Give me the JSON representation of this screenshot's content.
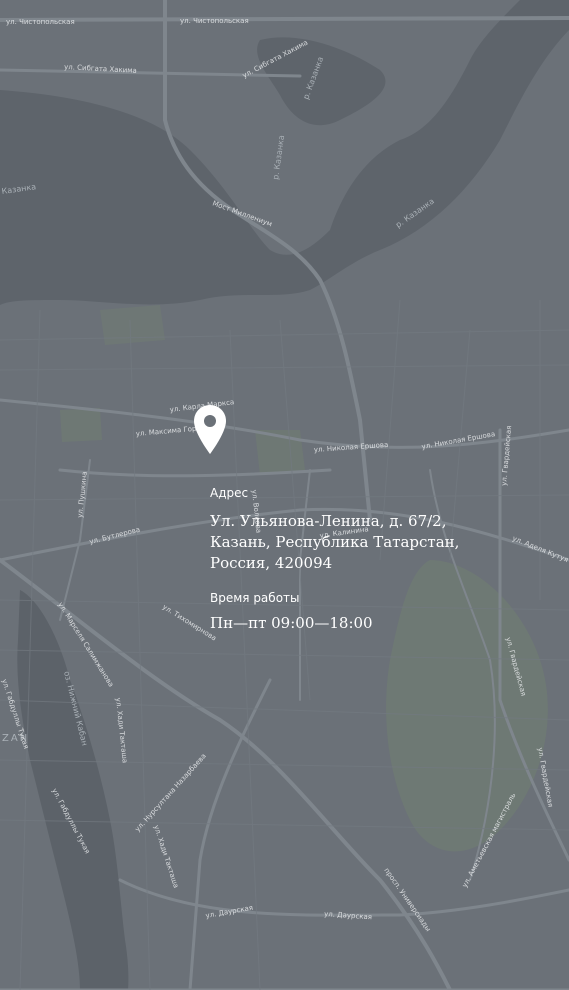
{
  "contact": {
    "address_label": "Адрес",
    "address_value": "Ул. Ульянова-Ленина, д. 67/2,\nКазань, Республика Татарстан,\nРоссия, 420094",
    "hours_label": "Время работы",
    "hours_value": "Пн—пт 09:00—18:00"
  },
  "map": {
    "marker_icon": "map-pin-icon",
    "colors": {
      "background": "#6b7178",
      "water": "#5d636a",
      "park": "#6e7a72",
      "road": "#7e858c",
      "text": "#ffffff"
    },
    "streets": [
      "ул. Чистопольская",
      "ул. Чистопольская",
      "ул. Сибгата Хакима",
      "ул. Сибгата Хакима",
      "Мост Миллениум",
      "ул. Карла Маркса",
      "ул. Максима Горького",
      "ул. Николая Ершова",
      "ул. Николая Ершова",
      "ул. Пушкина",
      "ул. Бутлерова",
      "ул. Гвардейская",
      "ул. Гвардейская",
      "ул. Гвардейская",
      "ул. Аделя Кутуя",
      "ул. Тихомирнова",
      "ул. Марселя Салимжанова",
      "ул. Хади Такташа",
      "ул. Хади Такташа",
      "ул. Нурсултана Назарбаева",
      "ул. Габдуллы Тукая",
      "ул. Габдуллы Тукая",
      "ул. Даурская",
      "ул. Даурская",
      "просп. Универсиады",
      "ул. Аметьевская магистраль",
      "ул. Волкова",
      "ул. Калинина"
    ],
    "water_labels": [
      "р. Казанка",
      "р. Казанка",
      "р. Казанка",
      "Казанка",
      "оз. Нижний Кабан"
    ],
    "city_label": "ZAN"
  }
}
